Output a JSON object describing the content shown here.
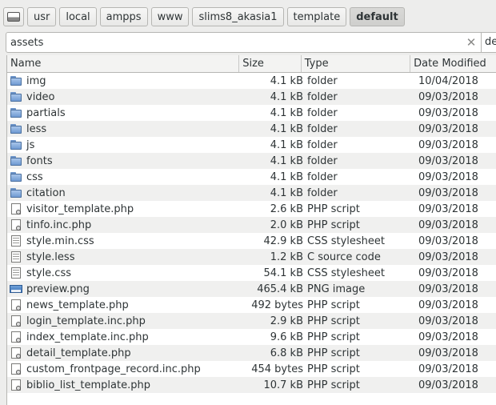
{
  "breadcrumb": [
    "usr",
    "local",
    "ampps",
    "www",
    "slims8_akasia1",
    "template",
    "default"
  ],
  "location": {
    "value": "assets",
    "side_value": "de"
  },
  "columns": {
    "name": "Name",
    "size": "Size",
    "type": "Type",
    "modified": "Date Modified"
  },
  "files": [
    {
      "name": "img",
      "size": "4.1 kB",
      "type": "folder",
      "modified": "10/04/2018",
      "icon": "folder"
    },
    {
      "name": "video",
      "size": "4.1 kB",
      "type": "folder",
      "modified": "09/03/2018",
      "icon": "folder"
    },
    {
      "name": "partials",
      "size": "4.1 kB",
      "type": "folder",
      "modified": "09/03/2018",
      "icon": "folder"
    },
    {
      "name": "less",
      "size": "4.1 kB",
      "type": "folder",
      "modified": "09/03/2018",
      "icon": "folder"
    },
    {
      "name": "js",
      "size": "4.1 kB",
      "type": "folder",
      "modified": "09/03/2018",
      "icon": "folder"
    },
    {
      "name": "fonts",
      "size": "4.1 kB",
      "type": "folder",
      "modified": "09/03/2018",
      "icon": "folder"
    },
    {
      "name": "css",
      "size": "4.1 kB",
      "type": "folder",
      "modified": "09/03/2018",
      "icon": "folder"
    },
    {
      "name": "citation",
      "size": "4.1 kB",
      "type": "folder",
      "modified": "09/03/2018",
      "icon": "folder"
    },
    {
      "name": "visitor_template.php",
      "size": "2.6 kB",
      "type": "PHP script",
      "modified": "09/03/2018",
      "icon": "script"
    },
    {
      "name": "tinfo.inc.php",
      "size": "2.0 kB",
      "type": "PHP script",
      "modified": "09/03/2018",
      "icon": "script"
    },
    {
      "name": "style.min.css",
      "size": "42.9 kB",
      "type": "CSS stylesheet",
      "modified": "09/03/2018",
      "icon": "doc"
    },
    {
      "name": "style.less",
      "size": "1.2 kB",
      "type": "C source code",
      "modified": "09/03/2018",
      "icon": "doc"
    },
    {
      "name": "style.css",
      "size": "54.1 kB",
      "type": "CSS stylesheet",
      "modified": "09/03/2018",
      "icon": "doc"
    },
    {
      "name": "preview.png",
      "size": "465.4 kB",
      "type": "PNG image",
      "modified": "09/03/2018",
      "icon": "image"
    },
    {
      "name": "news_template.php",
      "size": "492 bytes",
      "type": "PHP script",
      "modified": "09/03/2018",
      "icon": "script"
    },
    {
      "name": "login_template.inc.php",
      "size": "2.9 kB",
      "type": "PHP script",
      "modified": "09/03/2018",
      "icon": "script"
    },
    {
      "name": "index_template.inc.php",
      "size": "9.6 kB",
      "type": "PHP script",
      "modified": "09/03/2018",
      "icon": "script"
    },
    {
      "name": "detail_template.php",
      "size": "6.8 kB",
      "type": "PHP script",
      "modified": "09/03/2018",
      "icon": "script"
    },
    {
      "name": "custom_frontpage_record.inc.php",
      "size": "454 bytes",
      "type": "PHP script",
      "modified": "09/03/2018",
      "icon": "script"
    },
    {
      "name": "biblio_list_template.php",
      "size": "10.7 kB",
      "type": "PHP script",
      "modified": "09/03/2018",
      "icon": "script"
    }
  ]
}
